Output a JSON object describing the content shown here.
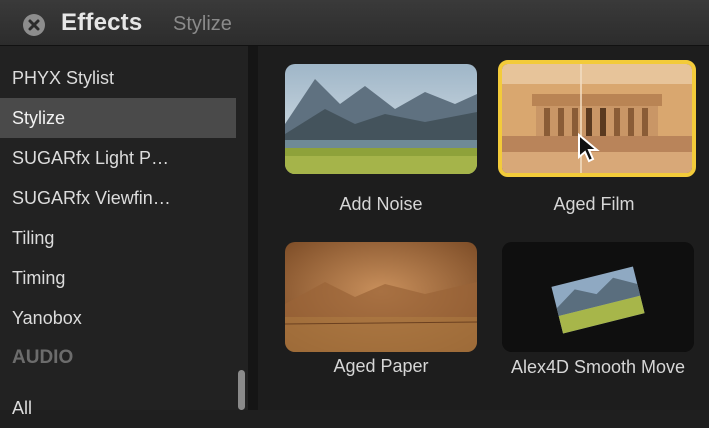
{
  "header": {
    "title": "Effects",
    "subtitle": "Stylize"
  },
  "sidebar": {
    "items": [
      {
        "label": "PHYX Stylist",
        "selected": false
      },
      {
        "label": "Stylize",
        "selected": true
      },
      {
        "label": "SUGARfx Light P…",
        "selected": false
      },
      {
        "label": "SUGARfx Viewfin…",
        "selected": false
      },
      {
        "label": "Tiling",
        "selected": false
      },
      {
        "label": "Timing",
        "selected": false
      },
      {
        "label": "Yanobox",
        "selected": false
      }
    ],
    "section_header": "AUDIO",
    "after_header_item": "All"
  },
  "effects": [
    {
      "label": "Add Noise",
      "thumbnail": "mountain-lake-photo",
      "selected": false
    },
    {
      "label": "Aged Film",
      "thumbnail": "lincoln-memorial-sepia",
      "selected": true
    },
    {
      "label": "Aged Paper",
      "thumbnail": "aged-paper-landscape",
      "selected": false
    },
    {
      "label": "Alex4D Smooth Move",
      "thumbnail": "tilted-landscape-card",
      "selected": false
    }
  ],
  "colors": {
    "selection_border": "#f3cb3a",
    "sidebar_selected": "#4a4a4a"
  }
}
